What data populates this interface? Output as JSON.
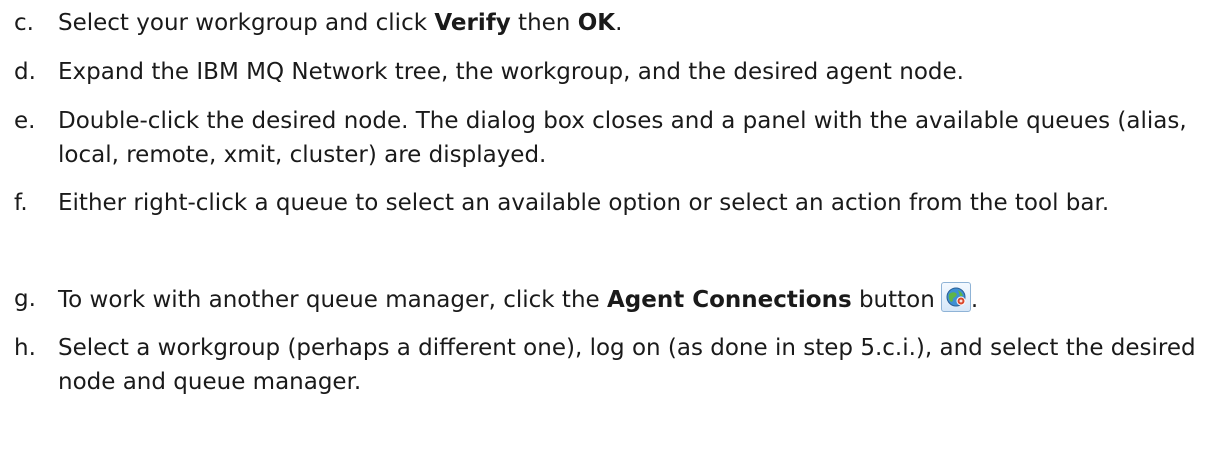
{
  "steps": {
    "c": {
      "marker": "c.",
      "pre": "Select your workgroup and click ",
      "bold1": "Verify",
      "mid": " then ",
      "bold2": "OK",
      "post": "."
    },
    "d": {
      "marker": "d.",
      "text": "Expand the IBM MQ Network tree, the workgroup, and the desired agent node."
    },
    "e": {
      "marker": "e.",
      "text": "Double-click the desired node.  The dialog box closes and a panel with the available queues (alias, local, remote, xmit, cluster) are displayed."
    },
    "f": {
      "marker": "f.",
      "text": "Either right-click a queue to select an available option or select an action from the tool bar."
    },
    "g": {
      "marker": "g.",
      "pre": "To work with another queue manager, click the ",
      "bold": "Agent Connections",
      "post_button": " button",
      "after_icon": ".",
      "icon": "agent-connections-icon"
    },
    "h": {
      "marker": "h.",
      "text": "Select a workgroup (perhaps a different one), log on (as done in step 5.c.i.), and select the desired node and queue manager."
    }
  }
}
